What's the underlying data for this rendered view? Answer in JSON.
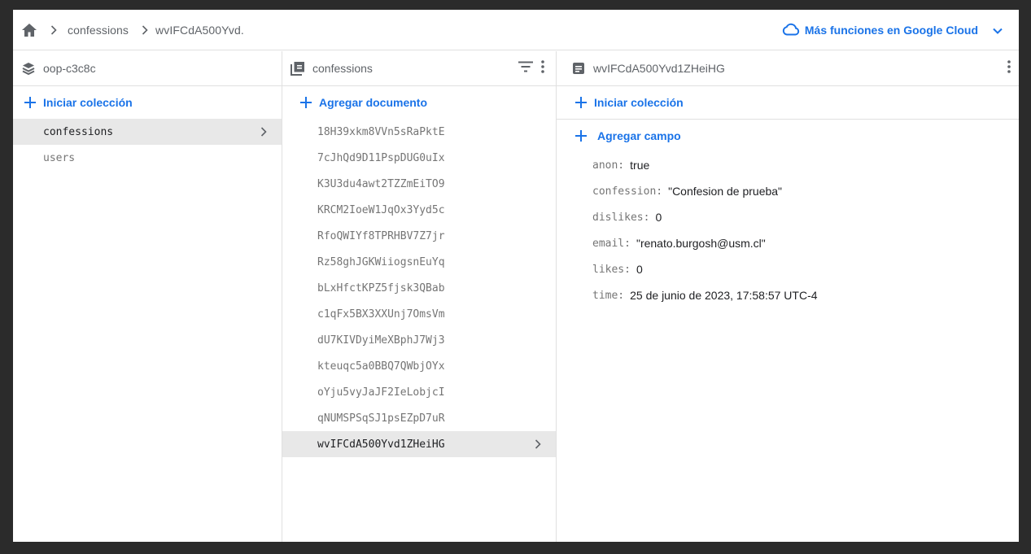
{
  "breadcrumb": {
    "home_icon": "home-icon",
    "items": [
      "confessions",
      "wvIFCdA500Yvd."
    ]
  },
  "header": {
    "cloud_link": "Más funciones en Google Cloud",
    "cloud_icon": "cloud-icon",
    "accent": "#1a73e8"
  },
  "project_col": {
    "title": "oop-c3c8c",
    "add_label": "Iniciar colección",
    "collections": [
      {
        "label": "confessions",
        "selected": true
      },
      {
        "label": "users",
        "selected": false
      }
    ]
  },
  "collection_col": {
    "title": "confessions",
    "add_label": "Agregar documento",
    "documents": [
      "18H39xkm8VVn5sRaPktE",
      "7cJhQd9D11PspDUG0uIx",
      "K3U3du4awt2TZZmEiTO9",
      "KRCM2IoeW1JqOx3Yyd5c",
      "RfoQWIYf8TPRHBV7Z7jr",
      "Rz58ghJGKWiiogsnEuYq",
      "bLxHfctKPZ5fjsk3QBab",
      "c1qFx5BX3XXUnj7OmsVm",
      "dU7KIVDyiMeXBphJ7Wj3",
      "kteuqc5a0BBQ7QWbjOYx",
      "oYju5vyJaJF2IeLobjcI",
      "qNUMSPSqSJ1psEZpD7uR",
      "wvIFCdA500Yvd1ZHeiHG"
    ],
    "selected_index": 12
  },
  "document_col": {
    "title": "wvIFCdA500Yvd1ZHeiHG",
    "add_collection_label": "Iniciar colección",
    "add_field_label": "Agregar campo",
    "fields": [
      {
        "name": "anon:",
        "value": "true"
      },
      {
        "name": "confession:",
        "value": "\"Confesion de prueba\""
      },
      {
        "name": "dislikes:",
        "value": "0"
      },
      {
        "name": "email:",
        "value": "\"renato.burgosh@usm.cl\""
      },
      {
        "name": "likes:",
        "value": "0"
      },
      {
        "name": "time:",
        "value": "25 de junio de 2023, 17:58:57 UTC-4"
      }
    ]
  }
}
